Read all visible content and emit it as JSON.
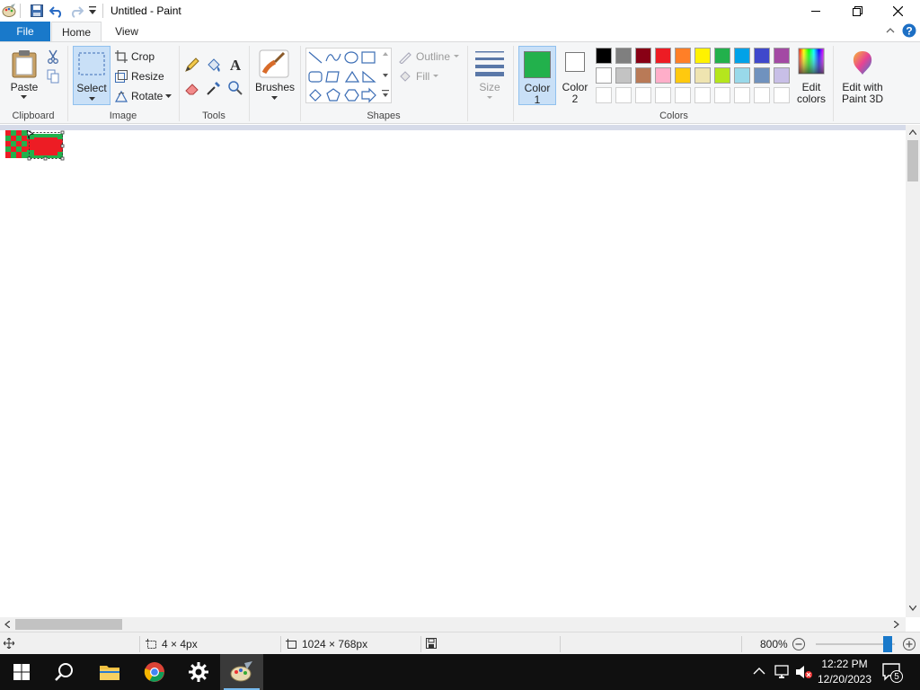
{
  "window": {
    "title": "Untitled - Paint",
    "minimize_icon": "minimize-icon",
    "maximize_icon": "restore-icon",
    "close_icon": "close-icon"
  },
  "tabs": {
    "file": "File",
    "home": "Home",
    "view": "View"
  },
  "clipboard": {
    "group_label": "Clipboard",
    "paste": "Paste"
  },
  "image": {
    "group_label": "Image",
    "select": "Select",
    "crop": "Crop",
    "resize": "Resize",
    "rotate": "Rotate"
  },
  "tools": {
    "group_label": "Tools"
  },
  "brushes": {
    "label": "Brushes"
  },
  "shapes": {
    "group_label": "Shapes",
    "outline": "Outline",
    "fill": "Fill"
  },
  "size": {
    "label": "Size"
  },
  "colors": {
    "group_label": "Colors",
    "color1_line1": "Color",
    "color1_line2": "1",
    "color2_line1": "Color",
    "color2_line2": "2",
    "color1_value": "#22b14c",
    "color2_value": "#ffffff",
    "edit_colors_line1": "Edit",
    "edit_colors_line2": "colors",
    "paint3d_line1": "Edit with",
    "paint3d_line2": "Paint 3D",
    "palette_row1": [
      "#000000",
      "#7f7f7f",
      "#880015",
      "#ed1c24",
      "#ff7f27",
      "#fff200",
      "#22b14c",
      "#00a2e8",
      "#3f48cc",
      "#a349a4"
    ],
    "palette_row2": [
      "#ffffff",
      "#c3c3c3",
      "#b97a57",
      "#ffaec9",
      "#ffc90e",
      "#efe4b0",
      "#b5e61d",
      "#99d9ea",
      "#7092be",
      "#c8bfe7"
    ]
  },
  "status": {
    "selection_size": "4 × 4px",
    "image_size": "1024 × 768px",
    "zoom": "800%"
  },
  "taskbar": {
    "time": "12:22 PM",
    "date": "12/20/2023",
    "notification_count": "5"
  }
}
